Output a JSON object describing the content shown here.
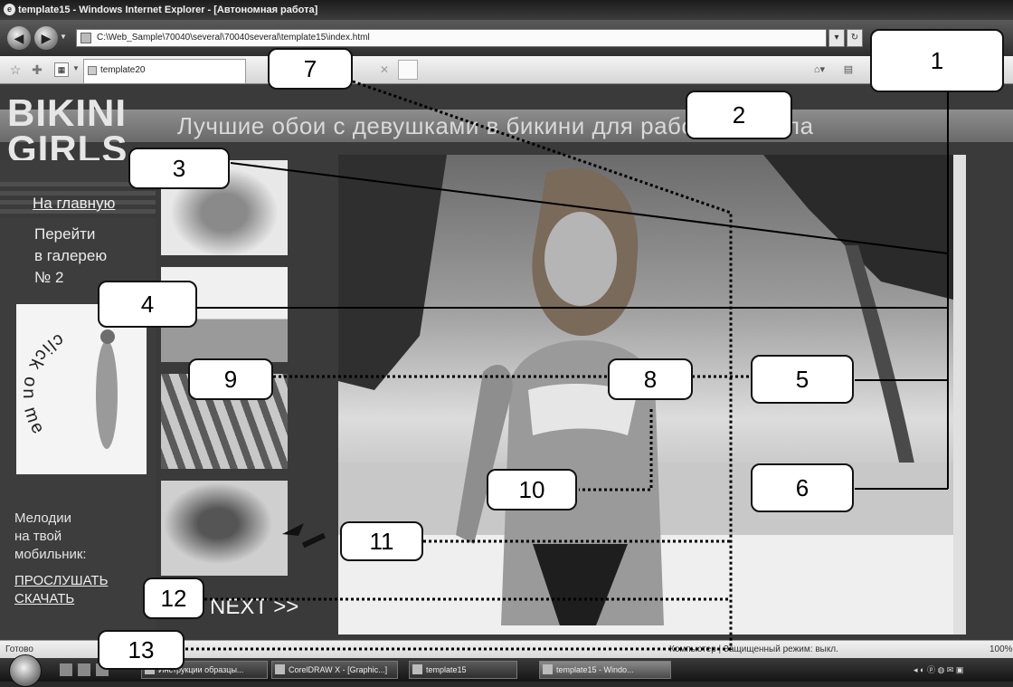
{
  "window": {
    "title": "template15 - Windows Internet Explorer - [Автономная работа]",
    "address": "C:\\Web_Sample\\70040\\several\\70040several\\template15\\index.html",
    "tab_title": "template20"
  },
  "page": {
    "logo": "BIKINI\nGIRLS",
    "tagline": "Лучшие обои с девушками в бикини для рабочего стола",
    "home_link": "На главную",
    "gallery_link": "Перейти\nв галерею\n№ 2",
    "click_text": "click on me",
    "ringtones": "Мелодии\nна твой\nмобильник:",
    "listen_link": "ПРОСЛУШАТЬ",
    "download_link": "СКАЧАТЬ",
    "next_link": "NEXT >>"
  },
  "statusbar": {
    "status": "Готово",
    "zone": "Компьютер | Защищенный режим: выкл.",
    "zoom": "100%"
  },
  "taskbar": {
    "buttons": [
      "Инструкции образцы...",
      "CorelDRAW X - [Graphic...]",
      "template15",
      "template15 - Windo..."
    ]
  },
  "callouts": [
    "1",
    "2",
    "3",
    "4",
    "5",
    "6",
    "7",
    "8",
    "9",
    "10",
    "11",
    "12",
    "13"
  ],
  "icons": {
    "back": "back-arrow-icon",
    "forward": "forward-arrow-icon",
    "favorites": "star-icon",
    "add_favorites": "add-favorites-icon",
    "home": "home-icon",
    "page_tools": "page-icon"
  }
}
